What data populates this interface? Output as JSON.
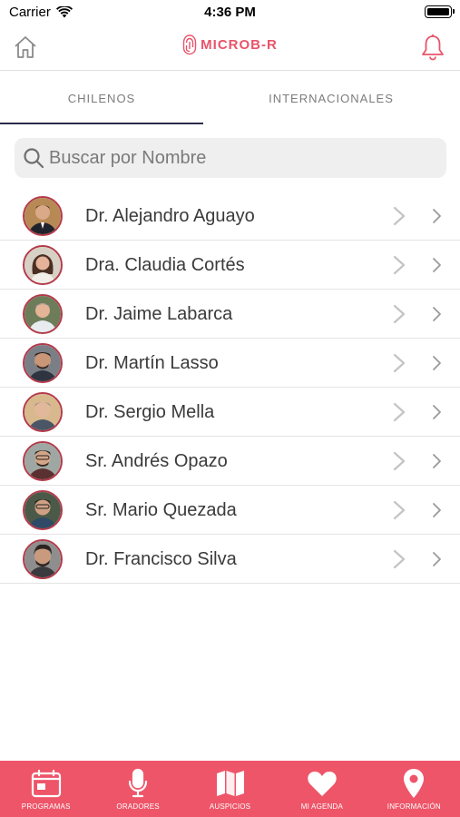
{
  "status_bar": {
    "carrier": "Carrier",
    "time": "4:36 PM"
  },
  "header": {
    "brand": "MICROB-R"
  },
  "tabs": [
    {
      "label": "CHILENOS",
      "active": true
    },
    {
      "label": "INTERNACIONALES",
      "active": false
    }
  ],
  "search": {
    "placeholder": "Buscar por Nombre",
    "value": ""
  },
  "speakers": [
    {
      "name": "Dr. Alejandro Aguayo"
    },
    {
      "name": "Dra. Claudia Cortés"
    },
    {
      "name": "Dr. Jaime Labarca"
    },
    {
      "name": "Dr. Martín Lasso"
    },
    {
      "name": "Dr. Sergio Mella"
    },
    {
      "name": "Sr. Andrés Opazo"
    },
    {
      "name": "Sr. Mario Quezada"
    },
    {
      "name": "Dr. Francisco Silva"
    }
  ],
  "bottom_tabs": [
    {
      "label": "PROGRAMAS",
      "icon": "calendar-icon"
    },
    {
      "label": "ORADORES",
      "icon": "microphone-icon"
    },
    {
      "label": "AUSPICIOS",
      "icon": "map-icon"
    },
    {
      "label": "MI AGENDA",
      "icon": "heart-icon"
    },
    {
      "label": "INFORMACIÓN",
      "icon": "location-pin-icon"
    }
  ],
  "colors": {
    "accent": "#ee5568",
    "brand": "#e8546a",
    "tab_underline": "#2b2b4d"
  }
}
